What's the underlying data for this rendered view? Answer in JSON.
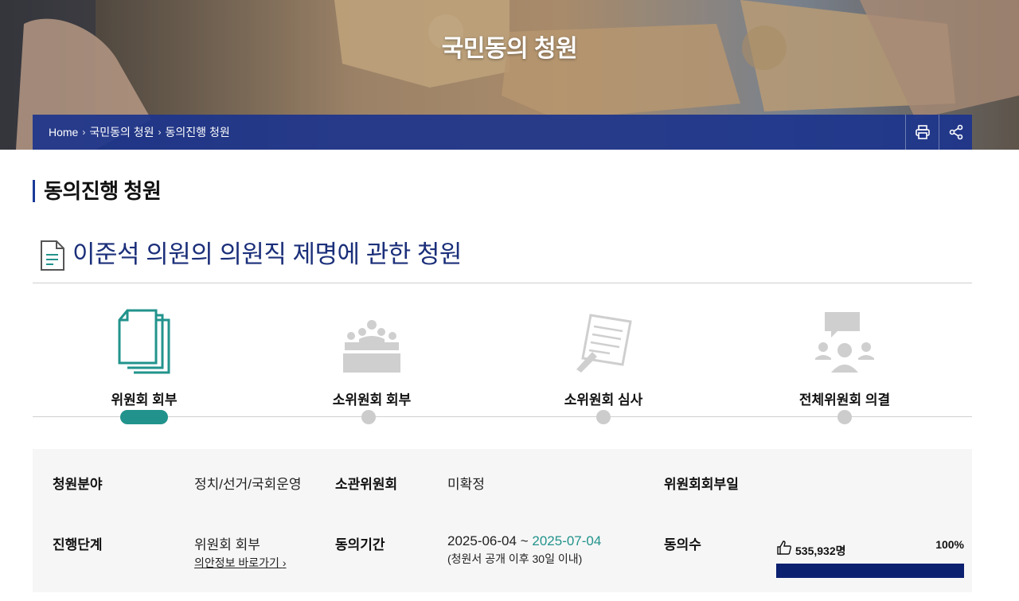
{
  "hero": {
    "title": "국민동의 청원"
  },
  "breadcrumb": {
    "items": [
      "Home",
      "국민동의 청원",
      "동의진행 청원"
    ],
    "separator": "›"
  },
  "header_actions": {
    "print_icon": "printer-icon",
    "share_icon": "share-icon"
  },
  "page": {
    "title": "동의진행 청원"
  },
  "petition": {
    "title": "이준석 의원의 의원직 제명에 관한 청원"
  },
  "steps": [
    {
      "label": "위원회 회부",
      "icon": "documents-icon",
      "active": true
    },
    {
      "label": "소위원회 회부",
      "icon": "meeting-icon",
      "active": false
    },
    {
      "label": "소위원회 심사",
      "icon": "review-document-icon",
      "active": false
    },
    {
      "label": "전체위원회 의결",
      "icon": "discussion-icon",
      "active": false
    }
  ],
  "info": {
    "field_label": "청원분야",
    "field_value": "정치/선거/국회운영",
    "committee_label": "소관위원회",
    "committee_value": "미확정",
    "referral_date_label": "위원회회부일",
    "referral_date_value": "",
    "stage_label": "진행단계",
    "stage_value": "위원회 회부",
    "stage_link": "의안정보 바로가기",
    "period_label": "동의기간",
    "period_start": "2025-06-04",
    "period_tilde": "~",
    "period_end": "2025-07-04",
    "period_note": "(청원서 공개 이후 30일 이내)",
    "agree_label": "동의수",
    "agree_count": "535,932명",
    "agree_percent_text": "100%",
    "agree_progress": 1.0
  },
  "colors": {
    "accent_teal": "#22938c",
    "navy": "#1b2f7a",
    "bar": "#0c2070",
    "crumb_bg": "#1c348c"
  }
}
